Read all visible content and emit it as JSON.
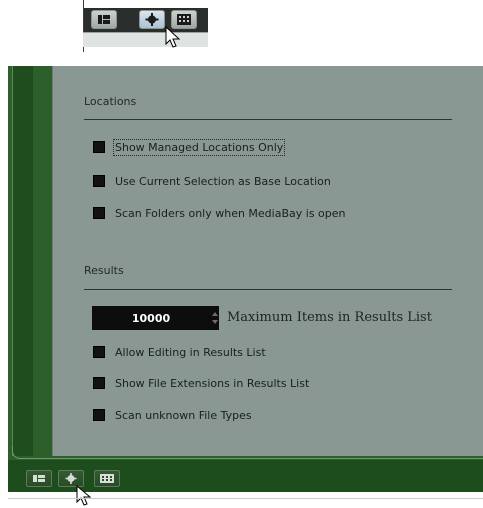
{
  "locations": {
    "title": "Locations",
    "options": [
      {
        "label": "Show Managed Locations Only",
        "checked": false,
        "focused": true
      },
      {
        "label": "Use Current Selection as Base Location",
        "checked": false,
        "focused": false
      },
      {
        "label": "Scan Folders only when MediaBay is open",
        "checked": false,
        "focused": false
      }
    ]
  },
  "results": {
    "title": "Results",
    "max_items": {
      "value": "10000",
      "label": "Maximum Items in Results List"
    },
    "options": [
      {
        "label": "Allow Editing in Results List",
        "checked": false
      },
      {
        "label": "Show File Extensions in Results List",
        "checked": false
      },
      {
        "label": "Scan unknown File Types",
        "checked": false
      }
    ]
  },
  "toolbar": {
    "buttons": [
      {
        "icon": "list-view-icon"
      },
      {
        "icon": "gear-icon",
        "active": true
      },
      {
        "icon": "grid-view-icon"
      }
    ]
  },
  "colors": {
    "panel_green": "#2d5f2b",
    "panel_body": "#8a9894",
    "active_button": "#b7cfe0"
  }
}
